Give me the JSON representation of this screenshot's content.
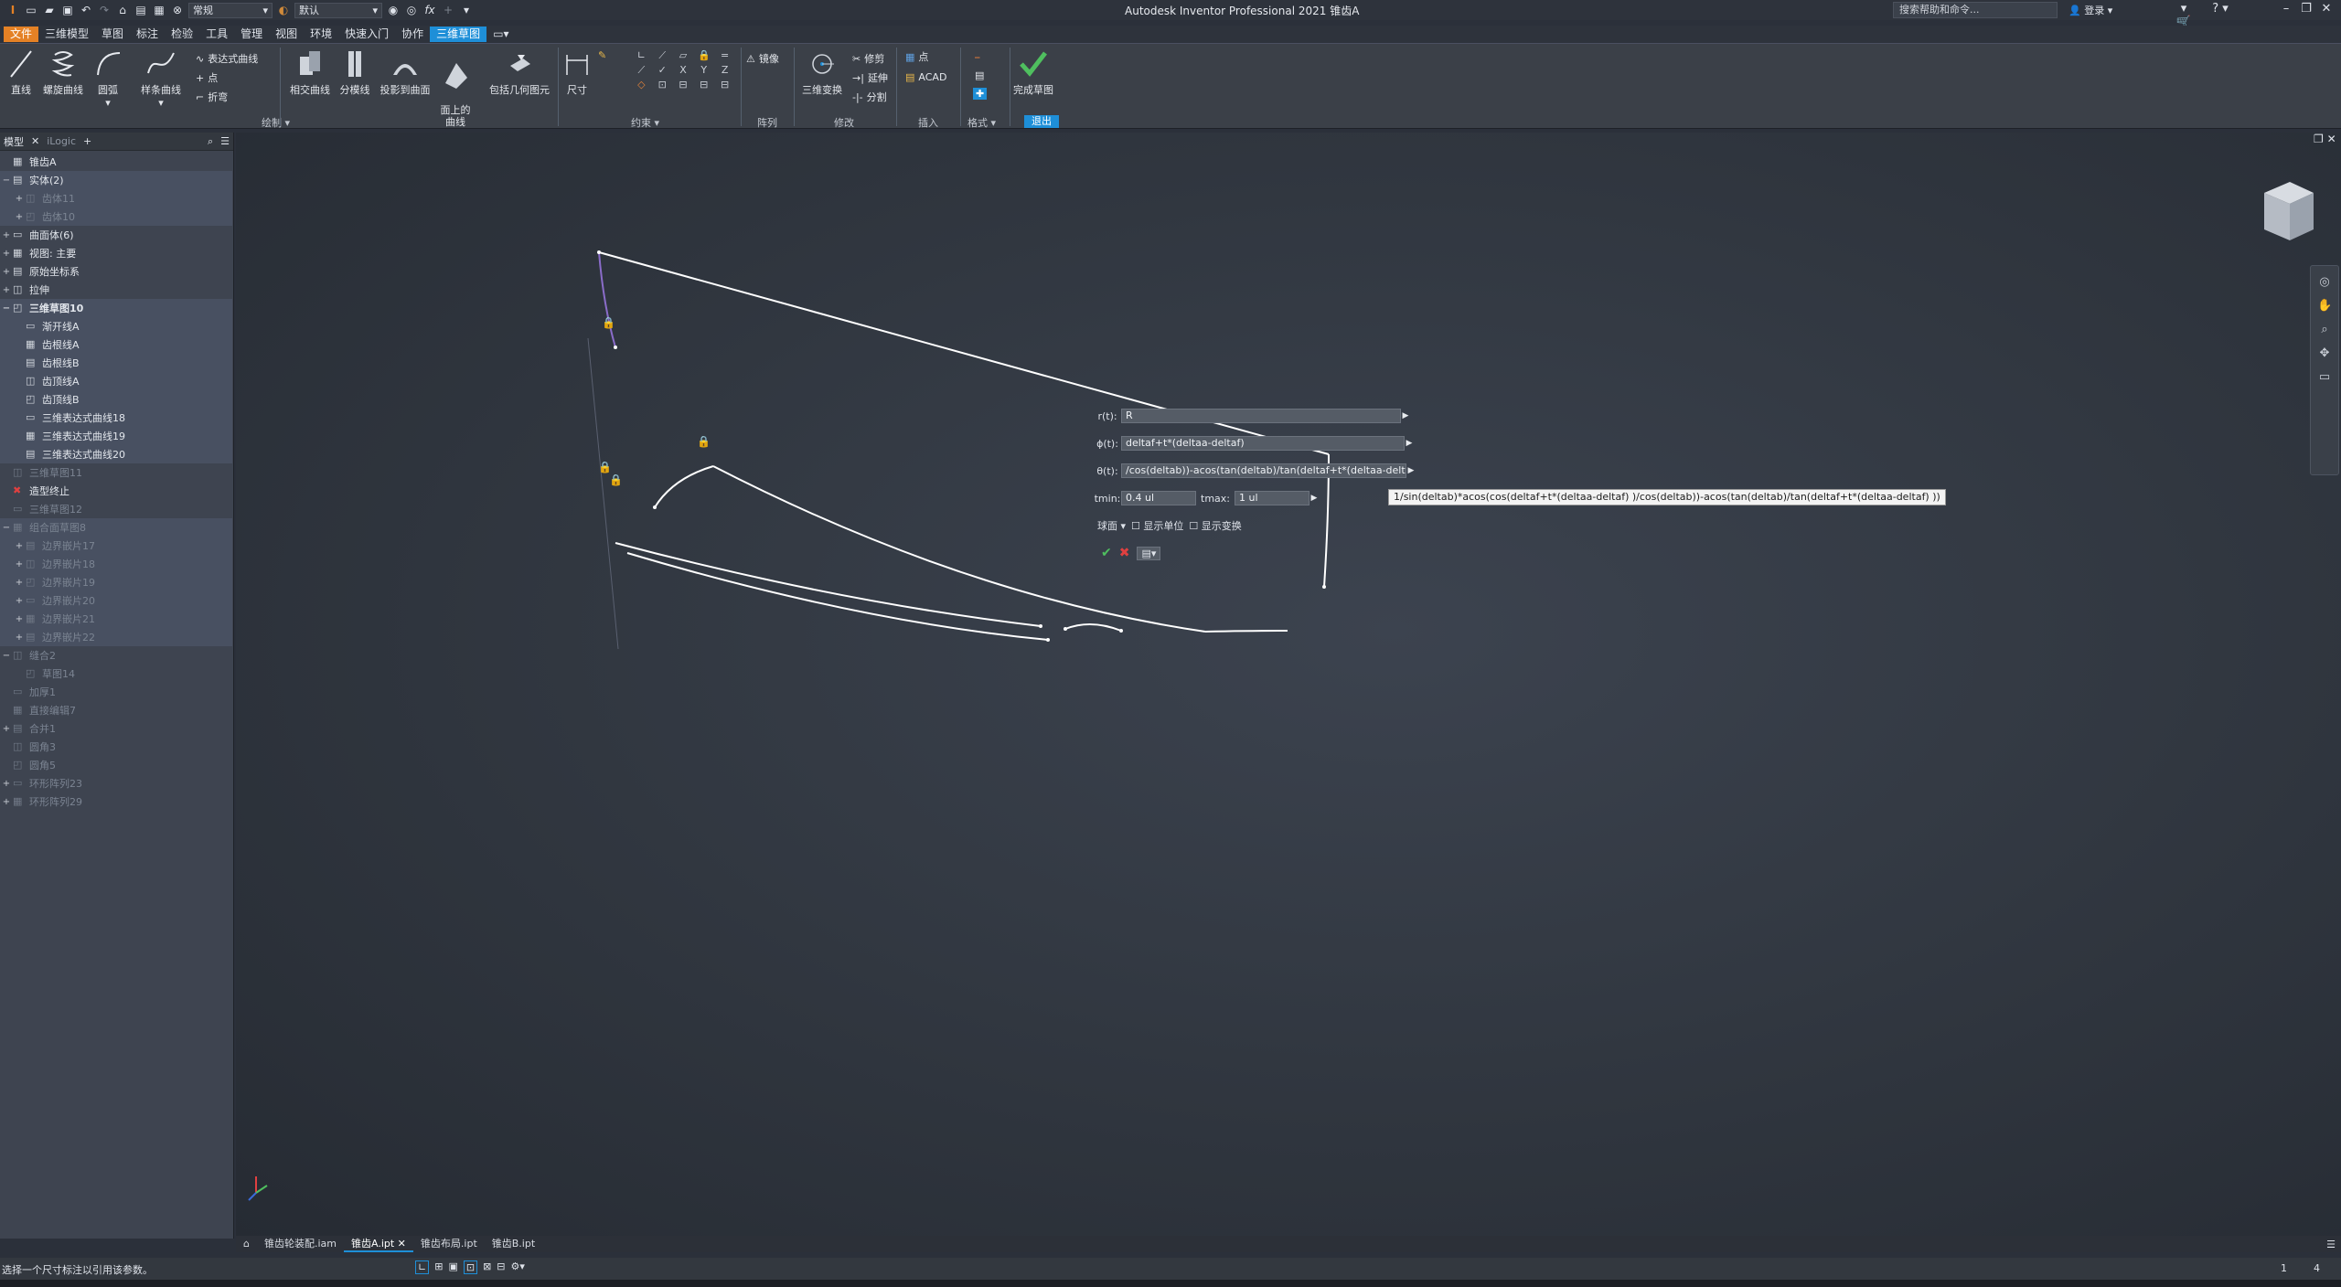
{
  "titlebar": {
    "title": "Autodesk Inventor Professional 2021    锥齿A",
    "appearance_dropdown": "常规",
    "material_dropdown": "默认",
    "help_search_placeholder": "搜索帮助和命令...",
    "login": "登录"
  },
  "tabs": [
    "文件",
    "三维模型",
    "草图",
    "标注",
    "检验",
    "工具",
    "管理",
    "视图",
    "环境",
    "快速入门",
    "协作",
    "三维草图"
  ],
  "ribbon": {
    "draw": {
      "line": "直线",
      "helix": "螺旋曲线",
      "arc": "圆弧",
      "spline": "样条曲线",
      "equation_curve": "表达式曲线",
      "point": "点",
      "bend": "折弯",
      "group": "绘制"
    },
    "intersect": "相交曲线",
    "silhouette": "分模线",
    "project_to_surface": "投影到曲面",
    "curve_on_face": "面上的\n曲线",
    "include_geometry": "包括几何图元",
    "dimension": "尺寸",
    "constrain_group": "约束",
    "mirror": "镜像",
    "pattern_group": "阵列",
    "transform3d": "三维变换",
    "trim": "修剪",
    "extend": "延伸",
    "split": "分割",
    "modify_group": "修改",
    "point_insert": "点",
    "acad": "ACAD",
    "insert_group": "插入",
    "format_group": "格式",
    "finish": "完成草图",
    "exit_group": "退出"
  },
  "browser": {
    "tabs": [
      "模型",
      "iLogic"
    ],
    "items": [
      {
        "label": "锥齿A",
        "indent": 0,
        "exp": "",
        "dim": false,
        "bold": false
      },
      {
        "label": "实体(2)",
        "indent": 0,
        "exp": "−",
        "dim": false,
        "bold": false
      },
      {
        "label": "齿体11",
        "indent": 1,
        "exp": "+",
        "dim": true,
        "bold": false
      },
      {
        "label": "齿体10",
        "indent": 1,
        "exp": "+",
        "dim": true,
        "bold": false
      },
      {
        "label": "曲面体(6)",
        "indent": 0,
        "exp": "+",
        "dim": false,
        "bold": false
      },
      {
        "label": "视图: 主要",
        "indent": 0,
        "exp": "+",
        "dim": false,
        "bold": false
      },
      {
        "label": "原始坐标系",
        "indent": 0,
        "exp": "+",
        "dim": false,
        "bold": false
      },
      {
        "label": "拉伸",
        "indent": 0,
        "exp": "+",
        "dim": false,
        "bold": false
      },
      {
        "label": "三维草图10",
        "indent": 0,
        "exp": "−",
        "dim": false,
        "bold": true
      },
      {
        "label": "渐开线A",
        "indent": 1,
        "exp": "",
        "dim": false,
        "bold": false
      },
      {
        "label": "齿根线A",
        "indent": 1,
        "exp": "",
        "dim": false,
        "bold": false
      },
      {
        "label": "齿根线B",
        "indent": 1,
        "exp": "",
        "dim": false,
        "bold": false
      },
      {
        "label": "齿顶线A",
        "indent": 1,
        "exp": "",
        "dim": false,
        "bold": false
      },
      {
        "label": "齿顶线B",
        "indent": 1,
        "exp": "",
        "dim": false,
        "bold": false
      },
      {
        "label": "三维表达式曲线18",
        "indent": 1,
        "exp": "",
        "dim": false,
        "bold": false
      },
      {
        "label": "三维表达式曲线19",
        "indent": 1,
        "exp": "",
        "dim": false,
        "bold": false
      },
      {
        "label": "三维表达式曲线20",
        "indent": 1,
        "exp": "",
        "dim": false,
        "bold": false
      },
      {
        "label": "三维草图11",
        "indent": 0,
        "exp": "",
        "dim": true,
        "bold": false
      },
      {
        "label": "造型终止",
        "indent": 0,
        "exp": "",
        "dim": false,
        "bold": false
      },
      {
        "label": "三维草图12",
        "indent": 0,
        "exp": "",
        "dim": true,
        "bold": false
      },
      {
        "label": "组合面草图8",
        "indent": 0,
        "exp": "−",
        "dim": true,
        "bold": false
      },
      {
        "label": "边界嵌片17",
        "indent": 1,
        "exp": "+",
        "dim": true,
        "bold": false
      },
      {
        "label": "边界嵌片18",
        "indent": 1,
        "exp": "+",
        "dim": true,
        "bold": false
      },
      {
        "label": "边界嵌片19",
        "indent": 1,
        "exp": "+",
        "dim": true,
        "bold": false
      },
      {
        "label": "边界嵌片20",
        "indent": 1,
        "exp": "+",
        "dim": true,
        "bold": false
      },
      {
        "label": "边界嵌片21",
        "indent": 1,
        "exp": "+",
        "dim": true,
        "bold": false
      },
      {
        "label": "边界嵌片22",
        "indent": 1,
        "exp": "+",
        "dim": true,
        "bold": false
      },
      {
        "label": "缝合2",
        "indent": 0,
        "exp": "−",
        "dim": true,
        "bold": false
      },
      {
        "label": "草图14",
        "indent": 1,
        "exp": "",
        "dim": true,
        "bold": false
      },
      {
        "label": "加厚1",
        "indent": 0,
        "exp": "",
        "dim": true,
        "bold": false
      },
      {
        "label": "直接编辑7",
        "indent": 0,
        "exp": "",
        "dim": true,
        "bold": false
      },
      {
        "label": "合并1",
        "indent": 0,
        "exp": "+",
        "dim": true,
        "bold": false
      },
      {
        "label": "圆角3",
        "indent": 0,
        "exp": "",
        "dim": true,
        "bold": false
      },
      {
        "label": "圆角5",
        "indent": 0,
        "exp": "",
        "dim": true,
        "bold": false
      },
      {
        "label": "环形阵列23",
        "indent": 0,
        "exp": "+",
        "dim": true,
        "bold": false
      },
      {
        "label": "环形阵列29",
        "indent": 0,
        "exp": "+",
        "dim": true,
        "bold": false
      }
    ]
  },
  "equation_dialog": {
    "r_label": "r(t):",
    "r_value": "R",
    "phi_label": "ϕ(t):",
    "phi_value": "deltaf+t*(deltaa-deltaf)",
    "theta_label": "θ(t):",
    "theta_value": "/cos(deltab))-acos(tan(deltab)/tan(deltaf+t*(deltaa-deltaf) ))",
    "tmin_label": "tmin:",
    "tmin_value": "0.4 ul",
    "tmax_label": "tmax:",
    "tmax_value": "1 ul",
    "coord_system": "球面",
    "show_units": "显示单位",
    "show_conversion": "显示变换",
    "tooltip": "1/sin(deltab)*acos(cos(deltaf+t*(deltaa-deltaf) )/cos(deltab))-acos(tan(deltab)/tan(deltaf+t*(deltaa-deltaf) ))"
  },
  "doc_tabs": [
    "锥齿轮装配.iam",
    "锥齿A.ipt",
    "锥齿布局.ipt",
    "锥齿B.ipt"
  ],
  "status": {
    "message": "选择一个尺寸标注以引用该参数。",
    "right1": "1",
    "right2": "4"
  },
  "colors": {
    "accent": "#1e8fd8",
    "file_tab": "#e48125",
    "sketch_line": "#ffffff",
    "selected_line": "#8a6cc9",
    "confirm": "#4fbf5f",
    "cancel": "#e04040"
  }
}
